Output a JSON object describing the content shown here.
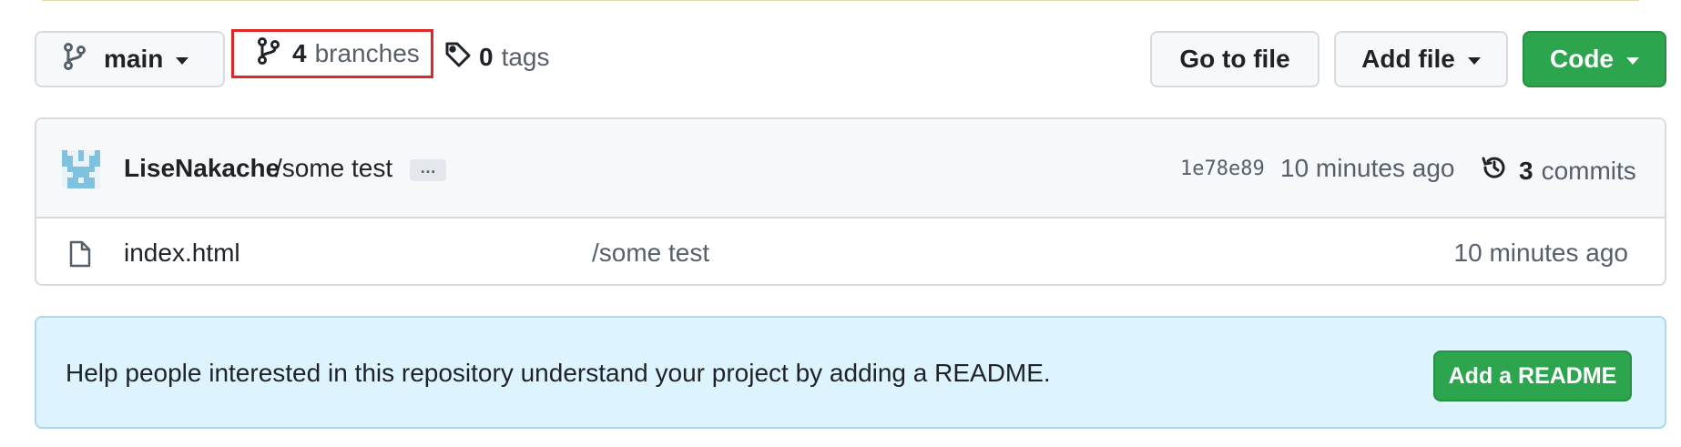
{
  "branch_selector": {
    "label": "main",
    "icon": "git-branch-icon"
  },
  "branches": {
    "count": "4",
    "label": "branches",
    "icon": "git-branch-icon"
  },
  "tags": {
    "count": "0",
    "label": "tags",
    "icon": "tag-icon"
  },
  "toolbar": {
    "goto_file": "Go to file",
    "add_file": "Add file",
    "code": "Code"
  },
  "latest_commit": {
    "author": "LiseNakache",
    "message": "/some test",
    "ellipsis": "…",
    "sha": "1e78e89",
    "time": "10 minutes ago",
    "commits_count": "3",
    "commits_label": "commits",
    "icon": "history-icon"
  },
  "files": [
    {
      "name": "index.html",
      "message": "/some test",
      "time": "10 minutes ago",
      "icon": "file-icon"
    }
  ],
  "readme_banner": {
    "text": "Help people interested in this repository understand your project by adding a README.",
    "button": "Add a README"
  },
  "colors": {
    "primary_green": "#2da44e",
    "highlight_red": "#e02626",
    "banner_blue": "#ddf4ff"
  }
}
